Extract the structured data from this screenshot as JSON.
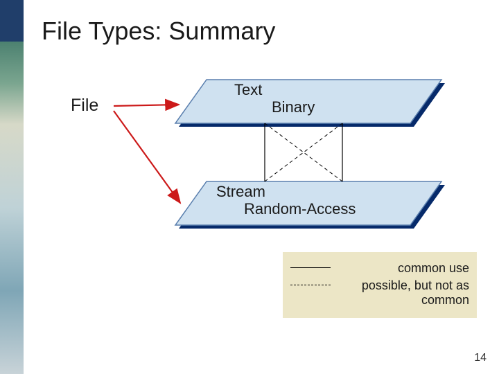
{
  "title": "File Types: Summary",
  "file_label": "File",
  "panel_top": {
    "label1": "Text",
    "label2": "Binary"
  },
  "panel_bottom": {
    "label1": "Stream",
    "label2": "Random-Access"
  },
  "legend": {
    "solid": "common use",
    "dashed": "possible, but not as common"
  },
  "slide_number": "14"
}
